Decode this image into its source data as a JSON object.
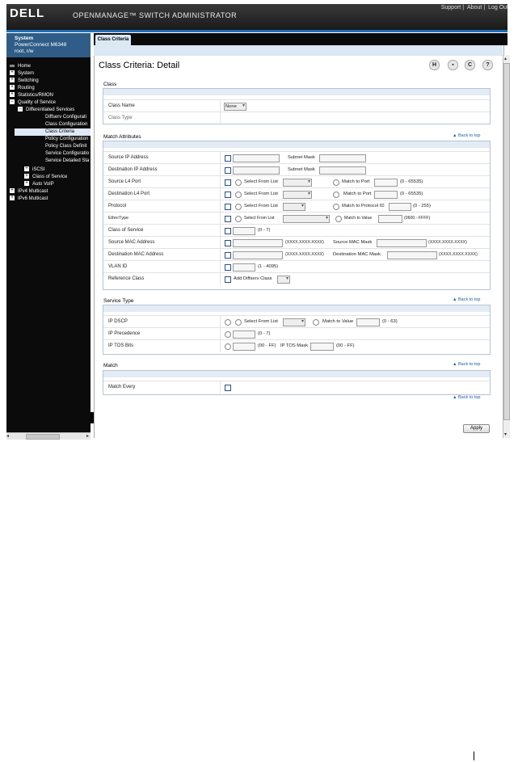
{
  "header": {
    "logo": "DELL",
    "title": "OPENMANAGE™ SWITCH ADMINISTRATOR",
    "links": [
      "Support",
      "About",
      "Log Out"
    ]
  },
  "sidebar": {
    "system_title": "System",
    "model": "PowerConnect M6348",
    "user": "root, r/w",
    "items": [
      {
        "label": "Home",
        "icon": "home"
      },
      {
        "label": "System",
        "icon": "+"
      },
      {
        "label": "Switching",
        "icon": "+"
      },
      {
        "label": "Routing",
        "icon": "+"
      },
      {
        "label": "Statistics/RMON",
        "icon": "+"
      },
      {
        "label": "Quality of Service",
        "icon": "-"
      },
      {
        "label": "Differentiated Services",
        "icon": "-"
      },
      {
        "label": "Diffserv Configurati",
        "icon": ""
      },
      {
        "label": "Class Configuration",
        "icon": ""
      },
      {
        "label": "Class Criteria",
        "icon": ""
      },
      {
        "label": "Policy Configuration",
        "icon": ""
      },
      {
        "label": "Policy Class Definit",
        "icon": ""
      },
      {
        "label": "Service Configuratio",
        "icon": ""
      },
      {
        "label": "Service Detailed Sta",
        "icon": ""
      },
      {
        "label": "iSCSI",
        "icon": "+"
      },
      {
        "label": "Class of Service",
        "icon": "+"
      },
      {
        "label": "Auto VoIP",
        "icon": "+"
      },
      {
        "label": "IPv4 Multicast",
        "icon": "+"
      },
      {
        "label": "IPv6 Multicast",
        "icon": "+"
      }
    ]
  },
  "tab": {
    "label": "Class Criteria"
  },
  "page": {
    "title": "Class Criteria: Detail"
  },
  "toolbar_icons": [
    "save-icon",
    "print-icon",
    "refresh-icon",
    "help-icon"
  ],
  "toolbar_glyphs": {
    "save": "H",
    "print": "▪",
    "refresh": "C",
    "help": "?"
  },
  "back_to_top": "▲ Back to top",
  "class_section": {
    "heading": "Class",
    "rows": [
      {
        "label": "Class Name",
        "value": "None"
      },
      {
        "label": "Class Type",
        "value": ""
      }
    ]
  },
  "match_attributes": {
    "heading": "Match Attributes",
    "source_ip": "Source IP Address",
    "dest_ip": "Destination IP Address",
    "subnet_mask": "Subnet Mask",
    "source_l4": "Source L4 Port",
    "dest_l4": "Destination L4 Port",
    "protocol": "Protocol",
    "ethertype": "EtherType",
    "cos": "Class of Service",
    "source_mac": "Source MAC Address",
    "dest_mac": "Destination MAC Address",
    "vlan": "VLAN ID",
    "ref_class": "Reference Class",
    "select_from_list": "Select From List",
    "match_to_port": "Match to Port",
    "port_range": "(0 - 65535)",
    "match_to_protocol": "Match to Protocol ID",
    "protocol_range": "(0 - 255)",
    "match_to_value": "Match to Value",
    "ethertype_range": "(0600 - FFFF)",
    "cos_range": "(0 - 7)",
    "mac_format": "(XXXX.XXXX.XXXX)",
    "source_mac_mask": "Source MAC Mask",
    "dest_mac_mask": "Destination MAC Mask",
    "vlan_range": "(1 - 4095)",
    "add_diffserv_class": "Add Diffserv Class"
  },
  "service_type": {
    "heading": "Service Type",
    "ip_dscp": "IP DSCP",
    "ip_precedence": "IP Precedence",
    "ip_tos": "IP TOS Bits",
    "select_from_list": "Select From List",
    "match_to_value": "Match to Value",
    "dscp_range": "(0 - 63)",
    "prec_range": "(0 - 7)",
    "tos_range": "(00 - FF)",
    "tos_mask": "IP TOS Mask",
    "tos_mask_range": "(00 - FF)"
  },
  "match_section": {
    "heading": "Match",
    "match_every": "Match Every"
  },
  "apply_label": "Apply"
}
